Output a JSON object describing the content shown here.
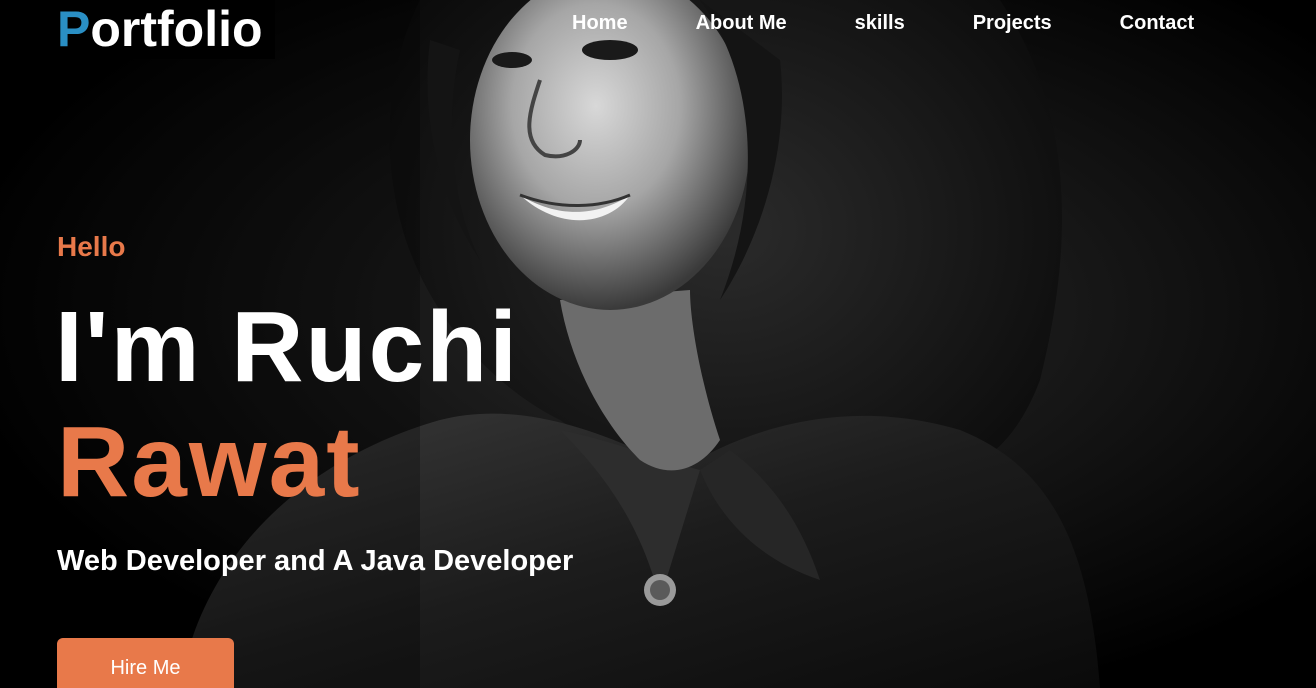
{
  "logo": {
    "initial": "P",
    "rest": "ortfolio"
  },
  "nav": {
    "home": "Home",
    "about": "About Me",
    "skills": "skills",
    "projects": "Projects",
    "contact": "Contact"
  },
  "hero": {
    "greeting": "Hello",
    "name_line1": "I'm Ruchi",
    "name_line2": "Rawat",
    "tagline": "Web Developer and A Java Developer",
    "cta": "Hire Me"
  },
  "colors": {
    "accent": "#e8794a",
    "logo_initial": "#2a8fc4",
    "background": "#000000",
    "text": "#ffffff"
  }
}
